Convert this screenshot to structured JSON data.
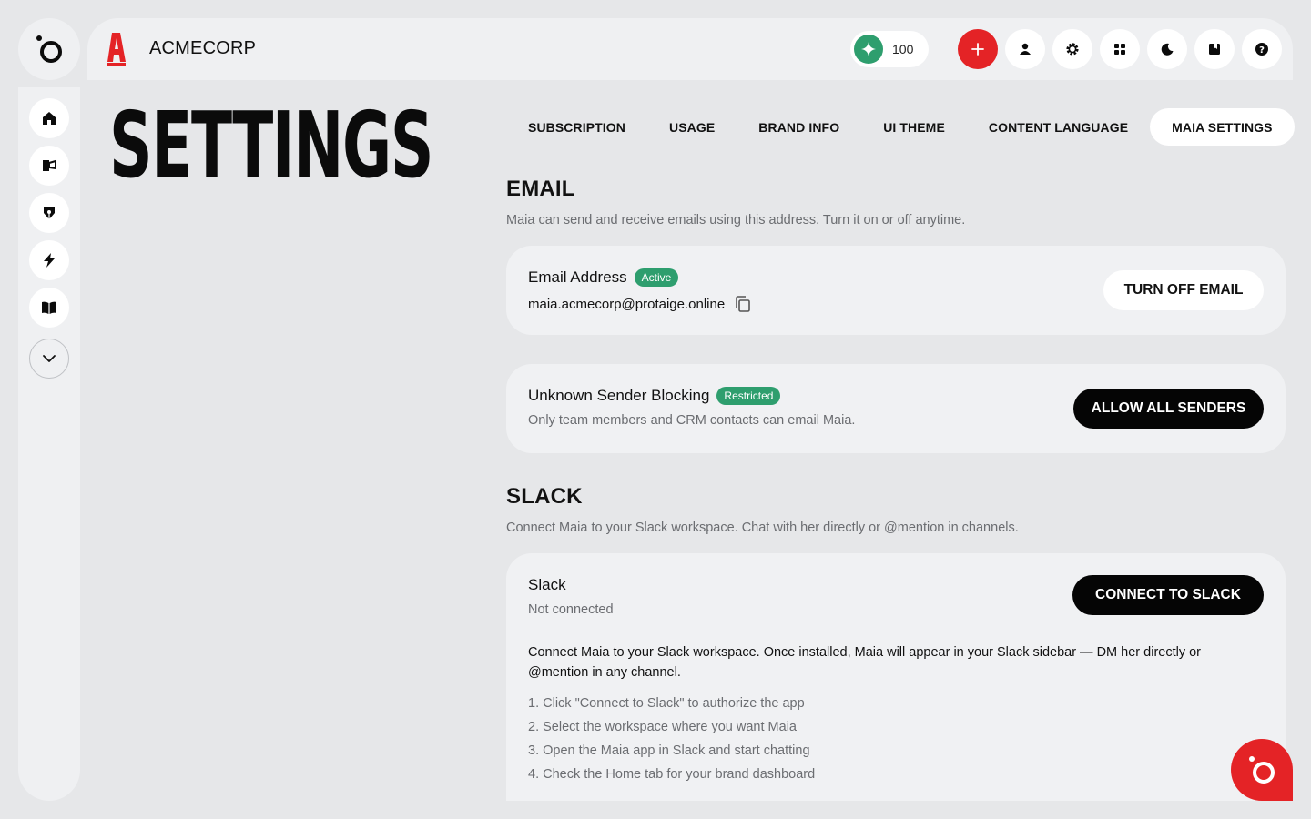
{
  "header": {
    "brand_name": "ACMECORP",
    "credits": "100",
    "colors": {
      "accent_red": "#e42326",
      "status_green": "#2e9e6e"
    }
  },
  "rail": {
    "items": [
      {
        "icon": "home-icon"
      },
      {
        "icon": "megaphone-icon"
      },
      {
        "icon": "pen-nib-icon"
      },
      {
        "icon": "lightning-icon"
      },
      {
        "icon": "book-icon"
      },
      {
        "icon": "chevron-down-icon"
      }
    ]
  },
  "page": {
    "title": "SETTINGS"
  },
  "tabs": [
    {
      "label": "SUBSCRIPTION",
      "active": false
    },
    {
      "label": "USAGE",
      "active": false
    },
    {
      "label": "BRAND INFO",
      "active": false
    },
    {
      "label": "UI THEME",
      "active": false
    },
    {
      "label": "CONTENT LANGUAGE",
      "active": false
    },
    {
      "label": "MAIA SETTINGS",
      "active": true
    }
  ],
  "email": {
    "title": "EMAIL",
    "description": "Maia can send and receive emails using this address. Turn it on or off anytime.",
    "address_card": {
      "label": "Email Address",
      "badge": "Active",
      "value": "maia.acmecorp@protaige.online",
      "button": "TURN OFF EMAIL"
    },
    "blocking_card": {
      "label": "Unknown Sender Blocking",
      "badge": "Restricted",
      "description": "Only team members and CRM contacts can email Maia.",
      "button": "ALLOW ALL SENDERS"
    }
  },
  "slack": {
    "title": "SLACK",
    "description": "Connect Maia to your Slack workspace. Chat with her directly or @mention in channels.",
    "card": {
      "label": "Slack",
      "status": "Not connected",
      "button": "CONNECT TO SLACK",
      "intro": "Connect Maia to your Slack workspace. Once installed, Maia will appear in your Slack sidebar — DM her directly or @mention in any channel.",
      "steps": [
        "1. Click \"Connect to Slack\" to authorize the app",
        "2. Select the workspace where you want Maia",
        "3. Open the Maia app in Slack and start chatting",
        "4. Check the Home tab for your brand dashboard"
      ]
    }
  }
}
